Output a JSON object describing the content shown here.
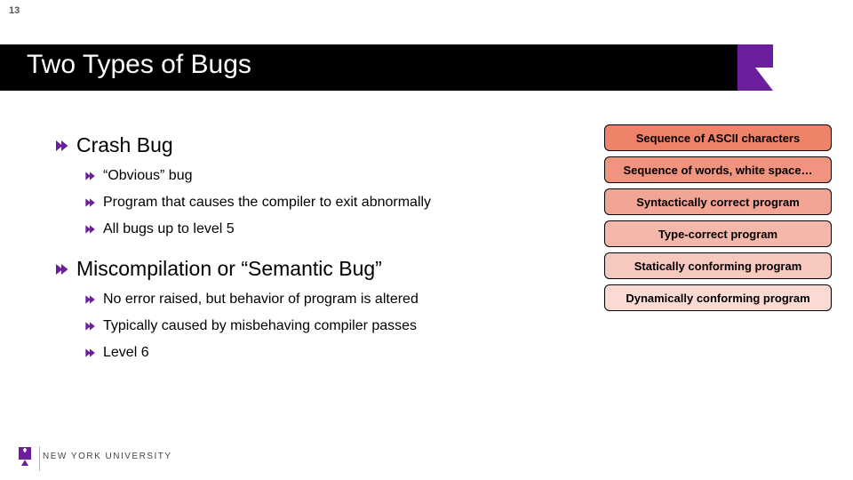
{
  "page_number": "13",
  "title": "Two Types of Bugs",
  "sections": [
    {
      "heading": "Crash Bug",
      "items": [
        "“Obvious” bug",
        "Program that causes the compiler to exit abnormally",
        "All bugs up to level 5"
      ]
    },
    {
      "heading": "Miscompilation or “Semantic Bug”",
      "items": [
        "No error raised, but behavior of program is altered",
        "Typically caused by misbehaving compiler passes",
        "Level 6"
      ]
    }
  ],
  "pills": [
    {
      "label": "Sequence of ASCII characters",
      "bg": "#ee836a"
    },
    {
      "label": "Sequence of words, white space…",
      "bg": "#f0947f"
    },
    {
      "label": "Syntactically correct program",
      "bg": "#f2a594"
    },
    {
      "label": "Type-correct program",
      "bg": "#f5b7a9"
    },
    {
      "label": "Statically conforming program",
      "bg": "#f7c8be"
    },
    {
      "label": "Dynamically conforming program",
      "bg": "#fadad3"
    }
  ],
  "footer": {
    "university": "NEW YORK UNIVERSITY"
  },
  "colors": {
    "purple": "#6b1f9e"
  }
}
